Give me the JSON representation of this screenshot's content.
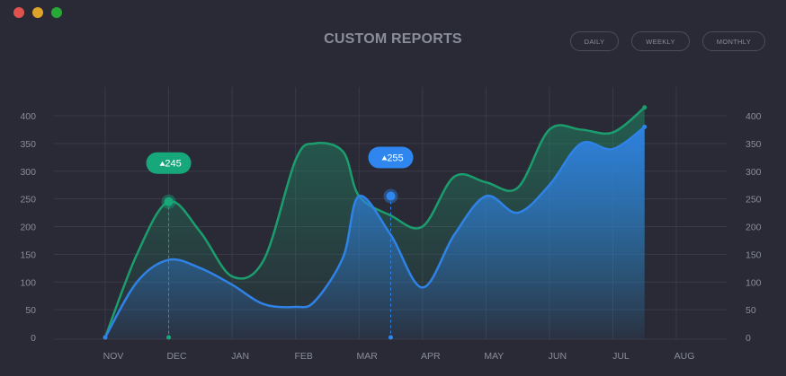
{
  "window": {
    "controls": [
      {
        "name": "close",
        "color": "#e0524e"
      },
      {
        "name": "minimize",
        "color": "#dea429"
      },
      {
        "name": "maximize",
        "color": "#27aa35"
      }
    ]
  },
  "header": {
    "title": "CUSTOM REPORTS",
    "range_buttons": [
      "DAILY",
      "WEEKLY",
      "MONTHLY"
    ]
  },
  "colors": {
    "green": "#1b9d6e",
    "blue": "#2f82e6",
    "grid": "#3a3b48",
    "background": "#2a2a36"
  },
  "chart_data": {
    "type": "area",
    "x": [
      0,
      0.5,
      1,
      1.5,
      2,
      2.5,
      3,
      3.3,
      3.75,
      4,
      4.5,
      5,
      5.5,
      6,
      6.5,
      7,
      7.5,
      8,
      8.5,
      9
    ],
    "categories": [
      "NOV",
      "DEC",
      "JAN",
      "FEB",
      "MAR",
      "APR",
      "MAY",
      "JUN",
      "JUL",
      "AUG"
    ],
    "ylim": [
      0,
      400
    ],
    "y_ticks": [
      0,
      50,
      100,
      150,
      200,
      250,
      300,
      350,
      400
    ],
    "right_axis": true,
    "grid": true,
    "series": [
      {
        "color": "#1b9d6e",
        "values": [
          0,
          150,
          245,
          190,
          110,
          140,
          320,
          350,
          335,
          255,
          220,
          200,
          290,
          280,
          270,
          375,
          375,
          370,
          415,
          null
        ]
      },
      {
        "color": "#2f82e6",
        "values": [
          0,
          100,
          140,
          125,
          95,
          60,
          55,
          65,
          145,
          255,
          185,
          90,
          185,
          255,
          225,
          275,
          350,
          340,
          380,
          null
        ]
      }
    ],
    "annotations": [
      {
        "series": 0,
        "x": 1,
        "y": 245,
        "label": "245",
        "color": "#16a87a"
      },
      {
        "series": 1,
        "x": 4.5,
        "y": 255,
        "label": "255",
        "color": "#2f86ee"
      }
    ]
  }
}
